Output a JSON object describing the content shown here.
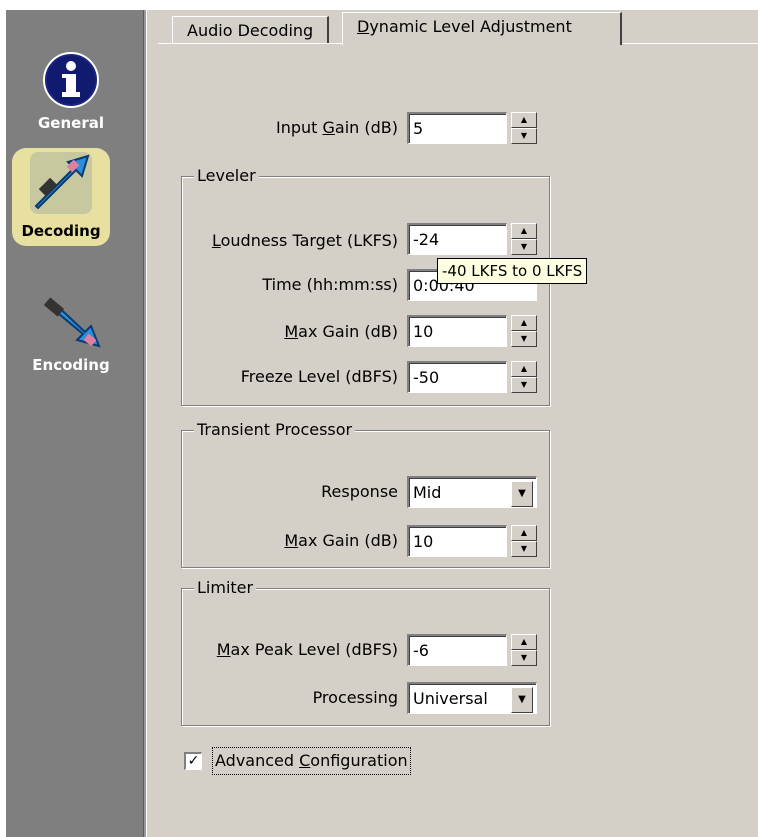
{
  "sidebar": {
    "items": [
      {
        "label": "General",
        "icon": "info-icon"
      },
      {
        "label": "Decoding",
        "icon": "decoding-icon",
        "selected": true
      },
      {
        "label": "Encoding",
        "icon": "encoding-icon"
      }
    ]
  },
  "tabs": [
    {
      "label": "Audio Decoding"
    },
    {
      "label_pre": "",
      "label_u": "D",
      "label_post": "ynamic Level Adjustment",
      "active": true
    }
  ],
  "input_gain": {
    "label_pre": "Input ",
    "label_u": "G",
    "label_post": "ain (dB)",
    "value": "5"
  },
  "leveler": {
    "title": "Leveler",
    "loudness": {
      "label_pre": "",
      "label_u": "L",
      "label_post": "oudness Target (LKFS)",
      "value": "-24"
    },
    "time": {
      "label": "Time (hh:mm:ss)",
      "value": "0:00:40"
    },
    "max_gain": {
      "label_pre": "",
      "label_u": "M",
      "label_post": "ax Gain (dB)",
      "value": "10"
    },
    "freeze": {
      "label": "Freeze Level (dBFS)",
      "value": "-50"
    }
  },
  "tooltip": "-40 LKFS to 0 LKFS",
  "transient": {
    "title": "Transient Processor",
    "response": {
      "label": "Response",
      "value": "Mid"
    },
    "max_gain": {
      "label_pre": "",
      "label_u": "M",
      "label_post": "ax Gain (dB)",
      "value": "10"
    }
  },
  "limiter": {
    "title": "Limiter",
    "max_peak": {
      "label_pre": "",
      "label_u": "M",
      "label_post": "ax Peak Level (dBFS)",
      "value": "-6"
    },
    "processing": {
      "label": "Processing",
      "value": "Universal"
    }
  },
  "advanced": {
    "label_pre": "Advanced ",
    "label_u": "C",
    "label_post": "onfiguration",
    "checked": true
  }
}
